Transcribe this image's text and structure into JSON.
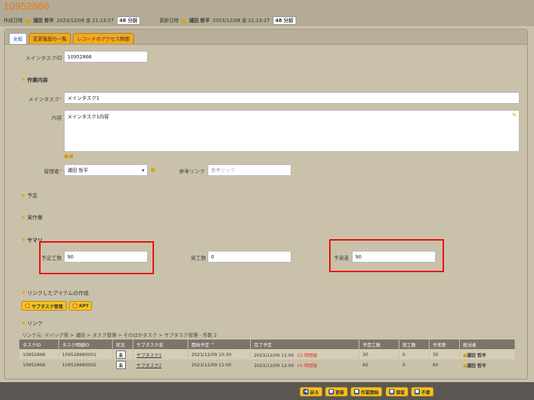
{
  "header": {
    "record_id": "10952866",
    "created_label": "作成日時",
    "created_by": "浦田 哲平",
    "created_at": "2023/12/08 金 21:13:27",
    "created_ago": "48 分前",
    "updated_label": "更新日時",
    "updated_by": "浦田 哲平",
    "updated_at": "2023/12/08 金 21:13:27",
    "updated_ago": "48 分前"
  },
  "tabs": [
    "全般",
    "変更履歴の一覧",
    "レコードのアクセス制御"
  ],
  "form": {
    "main_task_id_label": "メインタスクID",
    "main_task_id": "10952866",
    "work_section": "作業内容",
    "main_task_label": "メインタスク",
    "main_task_value": "メインタスク1",
    "content_label": "内容",
    "content_value": "メインタスク1内容",
    "manager_label": "管理者",
    "manager_value": "浦田 哲平",
    "ref_link_label": "参考リンク",
    "ref_link_placeholder": "参考リンク",
    "plan_section": "予定",
    "actual_section": "実作業",
    "summary_section": "サマリ",
    "planned_hours_label": "予定工数",
    "planned_hours": "90",
    "actual_hours_label": "実工数",
    "actual_hours": "0",
    "variance_label": "予実差",
    "variance": "90"
  },
  "linked_create": {
    "title": "リンクしたアイテムの作成",
    "buttons": [
      "サブタスク管理",
      "KPT"
    ]
  },
  "links": {
    "title": "リンク",
    "breadcrumb": "リンク元: デバッグ用 > 浦田 > タスク管理 > そのほかタスク > サブタスク管理 - 件数 2",
    "columns": [
      "タスクID",
      "タスク明細ID",
      "状況",
      "サブタスク名",
      "開始予定 ^",
      "完了予定",
      "予定工数",
      "実工数",
      "予実差",
      "担当者"
    ],
    "rows": [
      {
        "task_id": "10952866",
        "detail_id": "109528660001",
        "status": "未",
        "name": "サブタスク1",
        "start": "2023/12/09 10:30",
        "end": "2023/12/09 11:00",
        "end_note": "13 時間後",
        "planned": "30",
        "actual": "0",
        "variance": "30",
        "assignee": "浦田 哲平"
      },
      {
        "task_id": "10952866",
        "detail_id": "109528660002",
        "status": "未",
        "name": "サブタスク2",
        "start": "2023/12/09 11:00",
        "end": "2023/12/09 12:00",
        "end_note": "14 時間後",
        "planned": "60",
        "actual": "0",
        "variance": "60",
        "assignee": "浦田 哲平"
      }
    ]
  },
  "footer_buttons": [
    "戻る",
    "更新",
    "作業開始",
    "保留",
    "不要"
  ]
}
